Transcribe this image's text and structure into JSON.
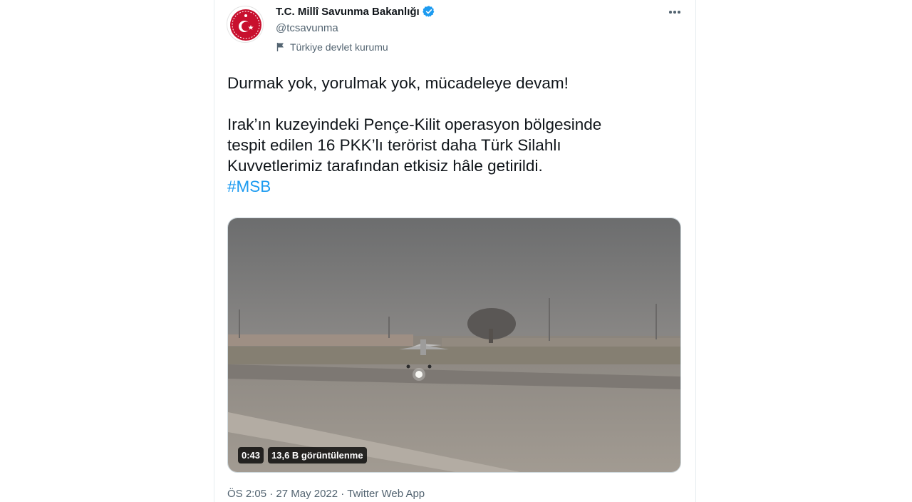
{
  "account": {
    "name": "T.C. Millî Savunma Bakanlığı",
    "handle": "@tcsavunma",
    "label": "Türkiye devlet kurumu",
    "verified_color": "#1d9bf0",
    "avatar_color": "#c8102e"
  },
  "tweet": {
    "line1": "Durmak yok, yorulmak yok, mücadeleye devam!",
    "line2": "Irak’ın kuzeyindeki Pençe-Kilit operasyon bölgesinde",
    "line3": "tespit edilen 16 PKK’lı terörist daha Türk Silahlı",
    "line4": "Kuvvetlerimiz tarafından etkisiz hâle getirildi.",
    "hashtag": "#MSB"
  },
  "video": {
    "duration": "0:43",
    "views": "13,6 B görüntülenme"
  },
  "meta": {
    "time": "ÖS 2:05",
    "separator": "·",
    "date": "27 May 2022",
    "source": "Twitter Web App"
  }
}
